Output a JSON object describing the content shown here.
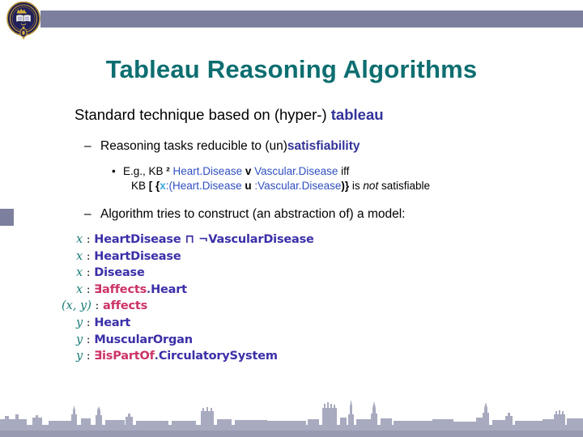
{
  "slide": {
    "title": "Tableau Reasoning Algorithms",
    "title_color": "#0d6e70",
    "header_bar_color": "#7c7f9e",
    "accent_square_color": "#7c7f9e",
    "crest_name": "oxford-university-crest",
    "skyline_name": "oxford-skyline-silhouette",
    "skyline_color": "#9a9cb4"
  },
  "bullets": {
    "level1": {
      "text_plain": "Standard technique based on (hyper-) tableau",
      "prefix": "Standard technique based on (hyper-) ",
      "emphasis": "tableau",
      "emphasis_color": "#333399"
    },
    "level2_a": {
      "dash": "–",
      "prefix": "Reasoning tasks reducible to (un)",
      "emphasis": "satisfiability",
      "emphasis_color": "#333399"
    },
    "level2_b": {
      "dash": "–",
      "text": "Algorithm tries to construct (an abstraction of) a model:"
    },
    "level3": {
      "bullet": "•",
      "line1": {
        "seg1": "E.g., KB ",
        "seg2": "²",
        "seg3": " ",
        "concept1": "Heart.Disease",
        "op": " v ",
        "concept2": "Vascular.Disease",
        "seg4": " iff"
      },
      "line2": {
        "seg1": "KB ",
        "bracket": "[",
        "brace_open": " {",
        "var": "x",
        "seg2": ":(",
        "concept1": "Heart.Disease",
        "op": " u ",
        "concept2": ":Vascular.Disease",
        "seg3": ")}",
        "seg4": " is ",
        "italic": "not",
        "seg5": " satisfiable"
      }
    }
  },
  "formulas": {
    "rows": [
      {
        "indent": true,
        "var": "x",
        "concept": "HeartDisease",
        "op": " ⊓ ¬",
        "concept2": "VascularDisease",
        "role": "",
        "role_concept": ""
      },
      {
        "indent": true,
        "var": "x",
        "concept": "HeartDisease",
        "op": "",
        "concept2": "",
        "role": "",
        "role_concept": ""
      },
      {
        "indent": true,
        "var": "x",
        "concept": "Disease",
        "op": "",
        "concept2": "",
        "role": "",
        "role_concept": ""
      },
      {
        "indent": true,
        "var": "x",
        "concept": "",
        "op": "",
        "concept2": "",
        "role": "∃affects",
        "role_concept": "Heart"
      },
      {
        "indent": false,
        "var": "(x, y)",
        "concept": "",
        "op": "",
        "concept2": "",
        "role": "affects",
        "role_concept": ""
      },
      {
        "indent": true,
        "var": "y",
        "concept": "Heart",
        "op": "",
        "concept2": "",
        "role": "",
        "role_concept": ""
      },
      {
        "indent": true,
        "var": "y",
        "concept": "MuscularOrgan",
        "op": "",
        "concept2": "",
        "role": "",
        "role_concept": ""
      },
      {
        "indent": true,
        "var": "y",
        "concept": "",
        "op": "",
        "concept2": "",
        "role": "∃isPartOf",
        "role_concept": "CirculatorySystem"
      }
    ],
    "colon": " : ",
    "dot": ".",
    "var_color": "#1a7f7a",
    "concept_color": "#3b2fa8",
    "role_color": "#cc3366"
  }
}
